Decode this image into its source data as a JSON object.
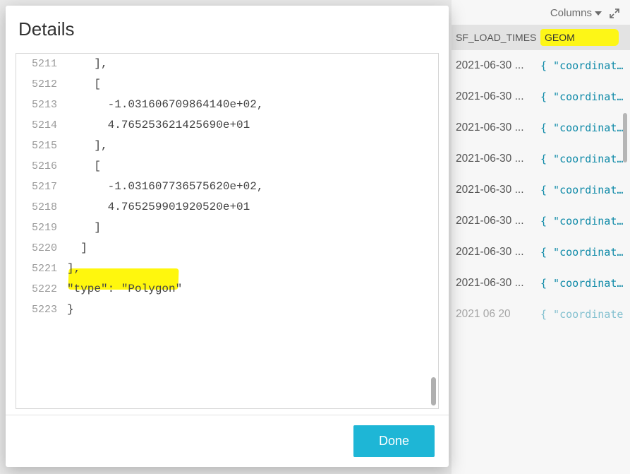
{
  "modal": {
    "title": "Details",
    "done_label": "Done",
    "highlight_text": "\"type\": \"Polygon\"",
    "code": [
      {
        "num": "5211",
        "text": "    ],"
      },
      {
        "num": "5212",
        "text": "    ["
      },
      {
        "num": "5213",
        "text": "      -1.031606709864140e+02,"
      },
      {
        "num": "5214",
        "text": "      4.765253621425690e+01"
      },
      {
        "num": "5215",
        "text": "    ],"
      },
      {
        "num": "5216",
        "text": "    ["
      },
      {
        "num": "5217",
        "text": "      -1.031607736575620e+02,"
      },
      {
        "num": "5218",
        "text": "      4.765259901920520e+01"
      },
      {
        "num": "5219",
        "text": "    ]"
      },
      {
        "num": "5220",
        "text": "  ]"
      },
      {
        "num": "5221",
        "text": "],"
      },
      {
        "num": "5222",
        "text": "\"type\": \"Polygon\""
      },
      {
        "num": "5223",
        "text": "}"
      }
    ]
  },
  "grid": {
    "columns_label": "Columns",
    "header": {
      "times": "SF_LOAD_TIMES",
      "geom": "GEOM"
    },
    "rows": [
      {
        "ts": "2021-06-30 ...",
        "geom": "{ \"coordinate..."
      },
      {
        "ts": "2021-06-30 ...",
        "geom": "{ \"coordinate..."
      },
      {
        "ts": "2021-06-30 ...",
        "geom": "{ \"coordinate..."
      },
      {
        "ts": "2021-06-30 ...",
        "geom": "{ \"coordinate..."
      },
      {
        "ts": "2021-06-30 ...",
        "geom": "{ \"coordinate..."
      },
      {
        "ts": "2021-06-30 ...",
        "geom": "{ \"coordinate..."
      },
      {
        "ts": "2021-06-30 ...",
        "geom": "{ \"coordinate..."
      },
      {
        "ts": "2021-06-30 ...",
        "geom": "{ \"coordinate..."
      },
      {
        "ts": "2021 06 20",
        "geom": "{ \"coordinate"
      }
    ]
  }
}
